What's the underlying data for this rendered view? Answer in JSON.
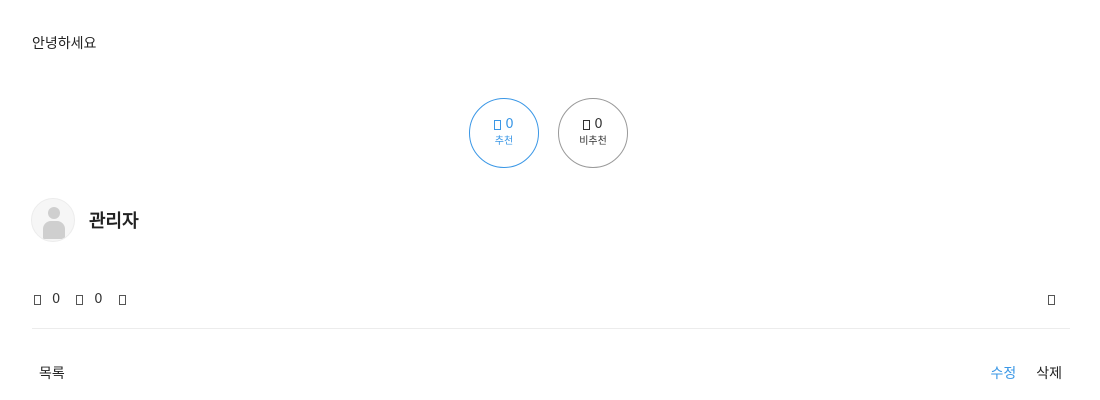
{
  "post": {
    "content": "안녕하세요"
  },
  "vote": {
    "up_count": "0",
    "up_label": "추천",
    "down_count": "0",
    "down_label": "비추천",
    "up_color": "#3a97e6",
    "down_border_color": "#999999"
  },
  "author": {
    "name": "관리자",
    "avatar_icon": "default-user-icon"
  },
  "meta": {
    "comment_count": "0",
    "view_count": "0",
    "comment_icon": "comment-icon",
    "view_icon": "eye-icon",
    "extra_icon": "more-icon",
    "share_icon": "share-icon"
  },
  "footer": {
    "list_label": "목록",
    "edit_label": "수정",
    "delete_label": "삭제"
  }
}
